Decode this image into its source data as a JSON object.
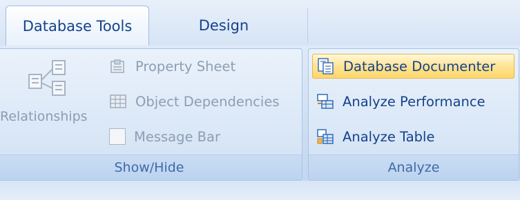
{
  "tabs": [
    {
      "label": "Database Tools",
      "active": true
    },
    {
      "label": "Design",
      "active": false
    }
  ],
  "show_hide": {
    "relationships_label": "Relationships",
    "property_sheet_label": "Property Sheet",
    "object_dependencies_label": "Object Dependencies",
    "message_bar_label": "Message Bar",
    "message_bar_checked": false,
    "group_label": "Show/Hide"
  },
  "analyze": {
    "database_documenter_label": "Database Documenter",
    "analyze_performance_label": "Analyze Performance",
    "analyze_table_label": "Analyze Table",
    "group_label": "Analyze"
  },
  "colors": {
    "accent": "#15428b",
    "disabled_text": "#8e9db3",
    "highlight": "#ffe59a"
  }
}
